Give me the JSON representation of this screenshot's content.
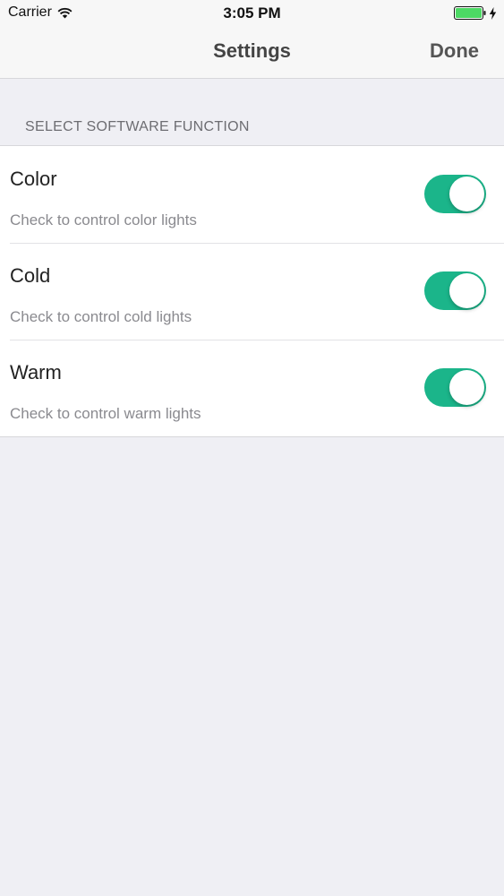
{
  "status_bar": {
    "carrier": "Carrier",
    "time": "3:05 PM",
    "icons": [
      "wifi-icon",
      "battery-icon",
      "charging-bolt-icon"
    ],
    "battery_color": "#4cd964"
  },
  "nav": {
    "title": "Settings",
    "done_label": "Done"
  },
  "section": {
    "header": "SELECT SOFTWARE FUNCTION"
  },
  "options": [
    {
      "title": "Color",
      "subtitle": "Check to control color lights",
      "enabled": true
    },
    {
      "title": "Cold",
      "subtitle": "Check to control cold lights",
      "enabled": true
    },
    {
      "title": "Warm",
      "subtitle": "Check to control warm lights",
      "enabled": true
    }
  ],
  "colors": {
    "toggle_on": "#1bb58a",
    "background": "#efeff4"
  }
}
